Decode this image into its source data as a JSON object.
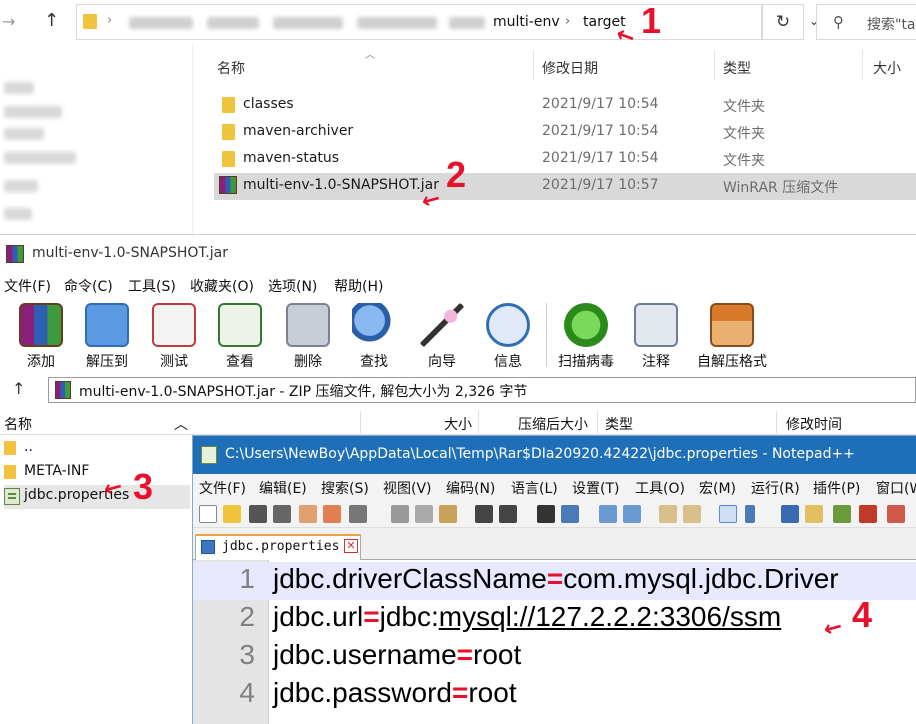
{
  "explorer": {
    "path": {
      "crumb_1": "multi-env",
      "crumb_2": "target",
      "sep": "›",
      "dropdown": "⌄",
      "refresh": "↻"
    },
    "search": {
      "icon": "search-icon",
      "placeholder": "搜索\"ta"
    },
    "columns": {
      "name": "名称",
      "date": "修改日期",
      "type": "类型",
      "size": "大小"
    },
    "rows": [
      {
        "name": "classes",
        "date": "2021/9/17 10:54",
        "type": "文件夹"
      },
      {
        "name": "maven-archiver",
        "date": "2021/9/17 10:54",
        "type": "文件夹"
      },
      {
        "name": "maven-status",
        "date": "2021/9/17 10:54",
        "type": "文件夹"
      },
      {
        "name": "multi-env-1.0-SNAPSHOT.jar",
        "date": "2021/9/17 10:57",
        "type": "WinRAR 压缩文件"
      }
    ]
  },
  "winrar": {
    "title": "multi-env-1.0-SNAPSHOT.jar",
    "menu": [
      "文件(F)",
      "命令(C)",
      "工具(S)",
      "收藏夹(O)",
      "选项(N)",
      "帮助(H)"
    ],
    "toolbar": [
      "添加",
      "解压到",
      "测试",
      "查看",
      "删除",
      "查找",
      "向导",
      "信息",
      "扫描病毒",
      "注释",
      "自解压格式"
    ],
    "path_text": "multi-env-1.0-SNAPSHOT.jar - ZIP 压缩文件, 解包大小为 2,326 字节",
    "columns": {
      "name": "名称",
      "size": "大小",
      "packed": "压缩后大小",
      "type": "类型",
      "modified": "修改时间"
    },
    "items": [
      "..",
      "META-INF",
      "jdbc.properties"
    ]
  },
  "notepad": {
    "title": "C:\\Users\\NewBoy\\AppData\\Local\\Temp\\Rar$DIa20920.42422\\jdbc.properties - Notepad++",
    "menu": [
      "文件(F)",
      "编辑(E)",
      "搜索(S)",
      "视图(V)",
      "编码(N)",
      "语言(L)",
      "设置(T)",
      "工具(O)",
      "宏(M)",
      "运行(R)",
      "插件(P)",
      "窗口(W)"
    ],
    "tab": "jdbc.properties",
    "tab_close": "✕",
    "lines": [
      {
        "num": "1",
        "key": "jdbc.driverClassName",
        "eq": "=",
        "val": "com.mysql.jdbc.Driver"
      },
      {
        "num": "2",
        "key": "jdbc.url",
        "eq": "=",
        "val_prefix": "jdbc:",
        "val": "mysql://127.2.2.2:3306/ssm"
      },
      {
        "num": "3",
        "key": "jdbc.username",
        "eq": "=",
        "val": "root"
      },
      {
        "num": "4",
        "key": "jdbc.password",
        "eq": "=",
        "val": "root"
      }
    ]
  },
  "annotations": [
    "1",
    "2",
    "3",
    "4"
  ],
  "colors": {
    "annotation": "#e8102a",
    "npp_title": "#1e6fb7",
    "folder": "#f0c33c"
  }
}
